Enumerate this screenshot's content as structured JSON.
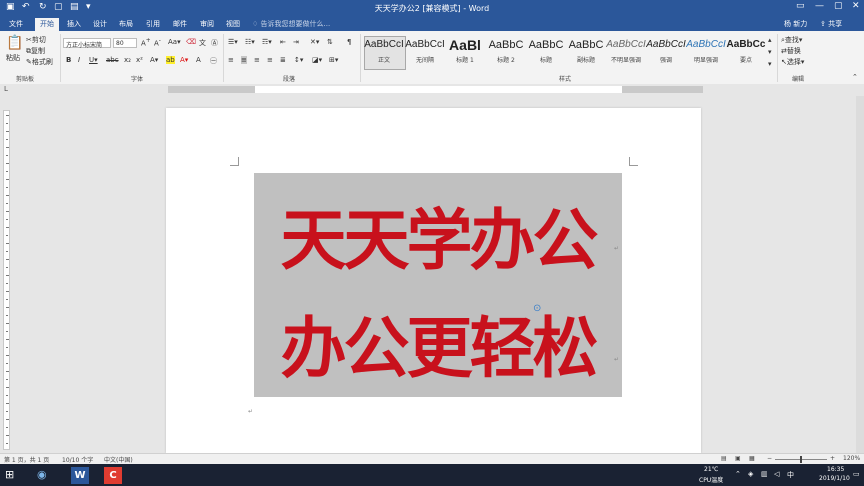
{
  "window": {
    "title": "天天学办公2 [兼容模式] - Word"
  },
  "tabs": [
    "文件",
    "开始",
    "插入",
    "设计",
    "布局",
    "引用",
    "邮件",
    "审阅",
    "视图"
  ],
  "tell_me": "告诉我您想要做什么...",
  "user": "杨 新力",
  "clipboard": {
    "paste": "粘贴",
    "cut": "剪切",
    "copy": "复制",
    "format_painter": "格式刷",
    "group": "剪贴板"
  },
  "font": {
    "name": "方正小标宋简",
    "size": "80",
    "group": "字体"
  },
  "paragraph": {
    "group": "段落"
  },
  "styles": {
    "group": "样式",
    "items": [
      {
        "preview": "AaBbCcI",
        "name": "正文"
      },
      {
        "preview": "AaBbCcI",
        "name": "无间隔"
      },
      {
        "preview": "AaBl",
        "name": "标题 1"
      },
      {
        "preview": "AaBbC",
        "name": "标题 2"
      },
      {
        "preview": "AaBbC",
        "name": "标题"
      },
      {
        "preview": "AaBbC",
        "name": "副标题"
      },
      {
        "preview": "AaBbCcI",
        "name": "不明显强调"
      },
      {
        "preview": "AaBbCcI",
        "name": "强调"
      },
      {
        "preview": "AaBbCcI",
        "name": "明显强调"
      },
      {
        "preview": "AaBbCc",
        "name": "要点"
      }
    ]
  },
  "editing": {
    "find": "查找",
    "replace": "替换",
    "select": "选择",
    "group": "编辑"
  },
  "document": {
    "line1": "天天学办公",
    "line2": "办公更轻松"
  },
  "status": {
    "page": "第 1 页，共 1 页",
    "words": "10/10 个字",
    "language": "中文(中国)",
    "zoom": "120%"
  },
  "taskbar": {
    "temp": "21℃",
    "cpu": "CPU温度",
    "time": "16:35",
    "date": "2019/1/10"
  },
  "colors": {
    "word_blue": "#2b579a",
    "text_red": "#c8111c"
  }
}
